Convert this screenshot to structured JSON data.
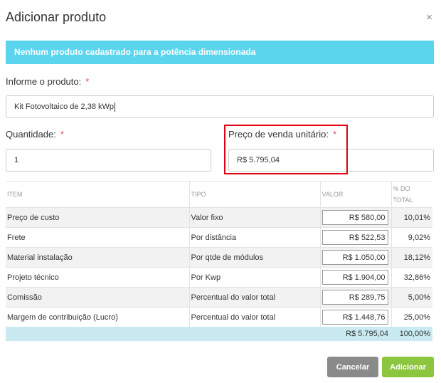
{
  "dialog": {
    "title": "Adicionar produto",
    "close_glyph": "×"
  },
  "alert": {
    "text": "Nenhum produto cadastrado para a potência dimensionada"
  },
  "product": {
    "label": "Informe o produto:",
    "required": "*",
    "value": "Kit Fotovoltaico de 2,38 kWp"
  },
  "quantity": {
    "label": "Quantidade:",
    "required": "*",
    "value": "1"
  },
  "price": {
    "label": "Preço de venda unitário:",
    "required": "*",
    "value": "R$ 5.795,04"
  },
  "table": {
    "headers": {
      "item": "ITEM",
      "tipo": "TIPO",
      "valor": "VALOR",
      "pct": "% DO TOTAL"
    },
    "rows": [
      {
        "item": "Preço de custo",
        "tipo": "Valor fixo",
        "valor": "R$ 580,00",
        "pct": "10,01%"
      },
      {
        "item": "Frete",
        "tipo": "Por distância",
        "valor": "R$ 522,53",
        "pct": "9,02%"
      },
      {
        "item": "Material instalação",
        "tipo": "Por qtde de módulos",
        "valor": "R$ 1.050,00",
        "pct": "18,12%"
      },
      {
        "item": "Projeto técnico",
        "tipo": "Por Kwp",
        "valor": "R$ 1.904,00",
        "pct": "32,86%"
      },
      {
        "item": "Comissão",
        "tipo": "Percentual do valor total",
        "valor": "R$ 289,75",
        "pct": "5,00%"
      },
      {
        "item": "Margem de contribuição (Lucro)",
        "tipo": "Percentual do valor total",
        "valor": "R$ 1.448,76",
        "pct": "25,00%"
      }
    ],
    "total": {
      "valor": "R$ 5.795,04",
      "pct": "100,00%"
    }
  },
  "buttons": {
    "cancel": "Cancelar",
    "add": "Adicionar"
  },
  "colors": {
    "alert_bg": "#5bd5ee",
    "cancel_bg": "#8a8a8a",
    "add_bg": "#8cc63f",
    "total_bg": "#c9eaf1",
    "highlight": "#e0000f"
  }
}
